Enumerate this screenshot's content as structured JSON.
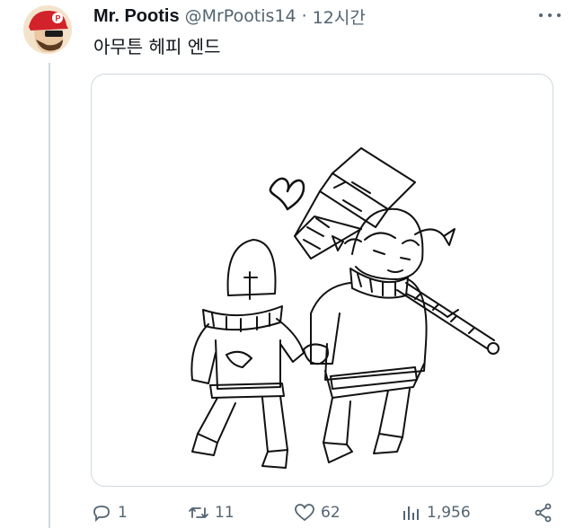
{
  "tweet": {
    "display_name": "Mr. Pootis",
    "handle": "@MrPootis14",
    "separator": "·",
    "time": "12시간",
    "text": "아무튼 헤피 엔드"
  },
  "media": {
    "description_icon": "drawing-image"
  },
  "actions": {
    "reply_count": "1",
    "retweet_count": "11",
    "like_count": "62",
    "view_count": "1,956"
  },
  "colors": {
    "text": "#0f1419",
    "secondary": "#536471",
    "border": "#cfd9de"
  }
}
